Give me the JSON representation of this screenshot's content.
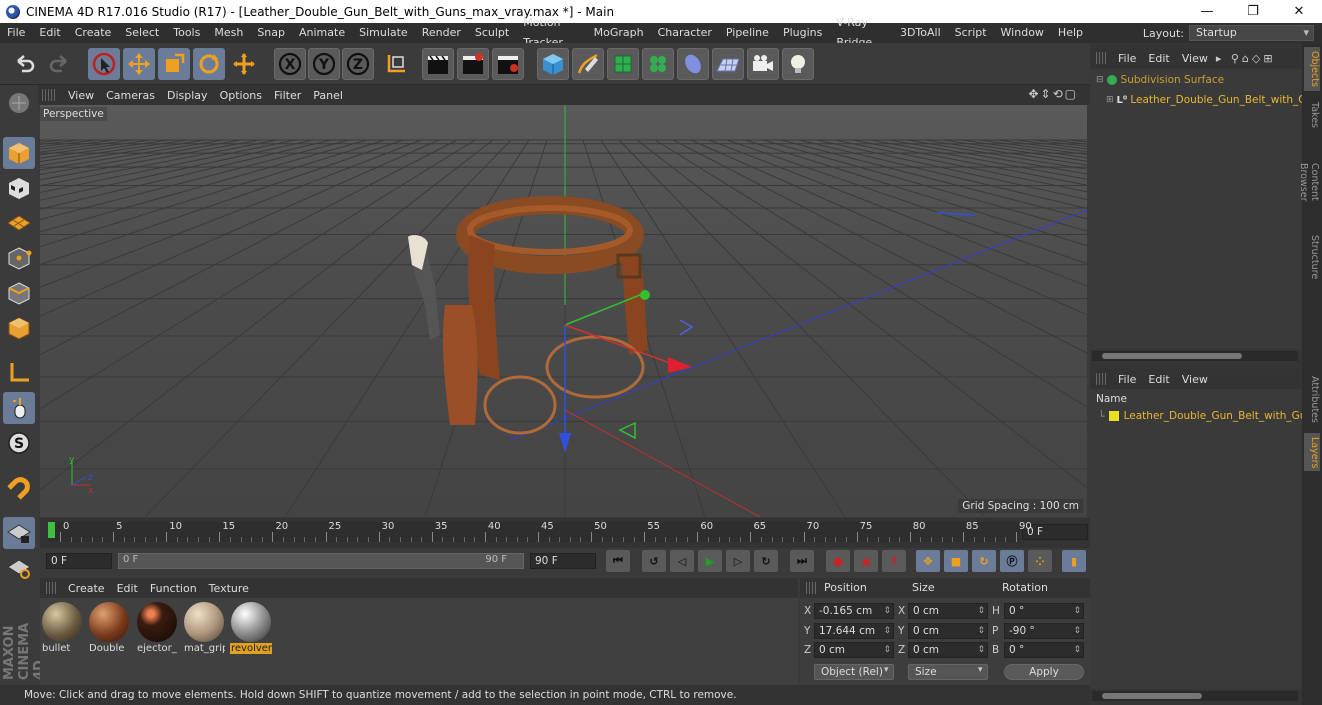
{
  "window": {
    "title": "CINEMA 4D R17.016 Studio (R17) - [Leather_Double_Gun_Belt_with_Guns_max_vray.max *] - Main",
    "controls": [
      "minimize",
      "restore",
      "close"
    ]
  },
  "menubar": [
    "File",
    "Edit",
    "Create",
    "Select",
    "Tools",
    "Mesh",
    "Snap",
    "Animate",
    "Simulate",
    "Render",
    "Sculpt",
    "Motion Tracker",
    "MoGraph",
    "Character",
    "Pipeline",
    "Plugins",
    "V-Ray Bridge",
    "3DToAll",
    "Script",
    "Window",
    "Help"
  ],
  "layout": {
    "label": "Layout:",
    "value": "Startup"
  },
  "toolbar": {
    "icons": [
      "undo-icon",
      "redo-icon",
      "live-selection-icon",
      "move-icon",
      "scale-icon",
      "rotate-icon",
      "recent-tools-icon",
      "x-axis-icon",
      "y-axis-icon",
      "z-axis-icon",
      "coordinate-system-icon",
      "render-view-icon",
      "render-picture-viewer-icon",
      "edit-render-settings-icon",
      "cube-icon",
      "pen-icon",
      "subdivision-icon",
      "cloner-icon",
      "deformer-icon",
      "floor-icon",
      "camera-icon",
      "light-icon"
    ]
  },
  "lefttools": [
    "make-editable-icon",
    "model-mode-icon",
    "texture-mode-icon",
    "workplane-icon",
    "points-mode-icon",
    "edges-mode-icon",
    "polygons-mode-icon",
    "axis-icon",
    "tweak-icon",
    "snap-icon",
    "magnet-icon",
    "lock-workplane-icon",
    "quantize-icon"
  ],
  "viewport": {
    "menu": [
      "View",
      "Cameras",
      "Display",
      "Options",
      "Filter",
      "Panel"
    ],
    "camera_label": "Perspective",
    "grid_spacing": "Grid Spacing : 100 cm"
  },
  "timeline": {
    "ticks": [
      "0",
      "5",
      "10",
      "15",
      "20",
      "25",
      "30",
      "35",
      "40",
      "45",
      "50",
      "55",
      "60",
      "65",
      "70",
      "75",
      "80",
      "85",
      "90"
    ],
    "current_frame": "0 F",
    "start_field": "0 F",
    "range_start": "0 F",
    "range_end": "90 F",
    "end_field": "90 F"
  },
  "materials": {
    "menu": [
      "Create",
      "Edit",
      "Function",
      "Texture"
    ],
    "items": [
      {
        "name": "bullet",
        "selected": false,
        "color": "#6a5a40"
      },
      {
        "name": "Double",
        "selected": false,
        "color": "#7a3a1c"
      },
      {
        "name": "ejector_",
        "selected": false,
        "color": "#2a160c"
      },
      {
        "name": "mat_grip",
        "selected": false,
        "color": "#b09a80"
      },
      {
        "name": "revolver",
        "selected": true,
        "color": "#8a8a8a"
      }
    ]
  },
  "attributes": {
    "headers": {
      "position": "Position",
      "size": "Size",
      "rotation": "Rotation"
    },
    "rows": [
      {
        "axis": "X",
        "position": "-0.165 cm",
        "size_axis": "X",
        "size": "0 cm",
        "rot_axis": "H",
        "rotation": "0 °"
      },
      {
        "axis": "Y",
        "position": "17.644 cm",
        "size_axis": "Y",
        "size": "0 cm",
        "rot_axis": "P",
        "rotation": "-90 °"
      },
      {
        "axis": "Z",
        "position": "0 cm",
        "size_axis": "Z",
        "size": "0 cm",
        "rot_axis": "B",
        "rotation": "0 °"
      }
    ],
    "coord_mode": "Object (Rel)",
    "size_mode": "Size",
    "apply_label": "Apply"
  },
  "objects_panel": {
    "menu": [
      "File",
      "Edit",
      "View"
    ],
    "items": [
      {
        "name": "Subdivision Surface",
        "level": 0,
        "color": "#c8a030"
      },
      {
        "name": "Leather_Double_Gun_Belt_with_Guns",
        "level": 1,
        "color": "#e8b830"
      }
    ]
  },
  "layers_panel": {
    "menu": [
      "File",
      "Edit",
      "View"
    ],
    "column": "Name",
    "items": [
      {
        "name": "Leather_Double_Gun_Belt_with_Guns",
        "color": "#e8e020"
      }
    ]
  },
  "right_tabs_top": [
    "Objects",
    "Takes",
    "Content Browser",
    "Structure"
  ],
  "right_tabs_bottom": [
    "Attributes",
    "Layers"
  ],
  "status": "Move: Click and drag to move elements. Hold down SHIFT to quantize movement / add to the selection in point mode, CTRL to remove.",
  "colors": {
    "accent": "#e8a020",
    "axis_x": "#e03030",
    "axis_y": "#30c030",
    "axis_z": "#3050e0"
  }
}
